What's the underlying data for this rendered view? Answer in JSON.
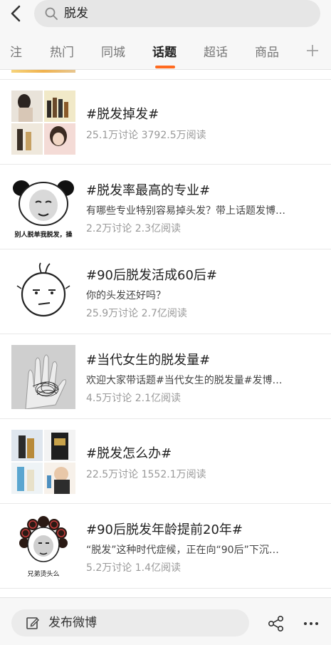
{
  "search": {
    "query": "脱发"
  },
  "tabs": [
    {
      "label": "注"
    },
    {
      "label": "热门"
    },
    {
      "label": "同城"
    },
    {
      "label": "话题"
    },
    {
      "label": "超话"
    },
    {
      "label": "商品"
    }
  ],
  "active_tab": "话题",
  "topics": [
    {
      "title": "#脱发掉发#",
      "desc": "",
      "stats": "25.1万讨论 3792.5万阅读"
    },
    {
      "title": "#脱发率最高的专业#",
      "desc": "有哪些专业特别容易掉头发？带上话题发博…",
      "stats": "2.2万讨论 2.3亿阅读",
      "thumb_caption": "别人脱单我脱发，操"
    },
    {
      "title": "#90后脱发活成60后#",
      "desc": "你的头发还好吗？",
      "stats": "25.9万讨论 2.7亿阅读"
    },
    {
      "title": "#当代女生的脱发量#",
      "desc": "欢迎大家带话题#当代女生的脱发量#发博…",
      "stats": "4.5万讨论 2.1亿阅读"
    },
    {
      "title": "#脱发怎么办#",
      "desc": "",
      "stats": "22.5万讨论 1552.1万阅读"
    },
    {
      "title": "#90后脱发年龄提前20年#",
      "desc": "“脱发”这种时代症候，正在向“90后”下沉…",
      "stats": "5.2万讨论 1.4亿阅读",
      "thumb_caption": "兄弟烫头么"
    }
  ],
  "bottom": {
    "compose_label": "发布微博"
  },
  "colors": {
    "accent": "#ff6a1f",
    "text": "#222222",
    "muted": "#999999"
  },
  "icons": [
    "back-arrow-icon",
    "search-icon",
    "add-tab-icon",
    "pen-icon",
    "share-icon",
    "more-icon"
  ]
}
